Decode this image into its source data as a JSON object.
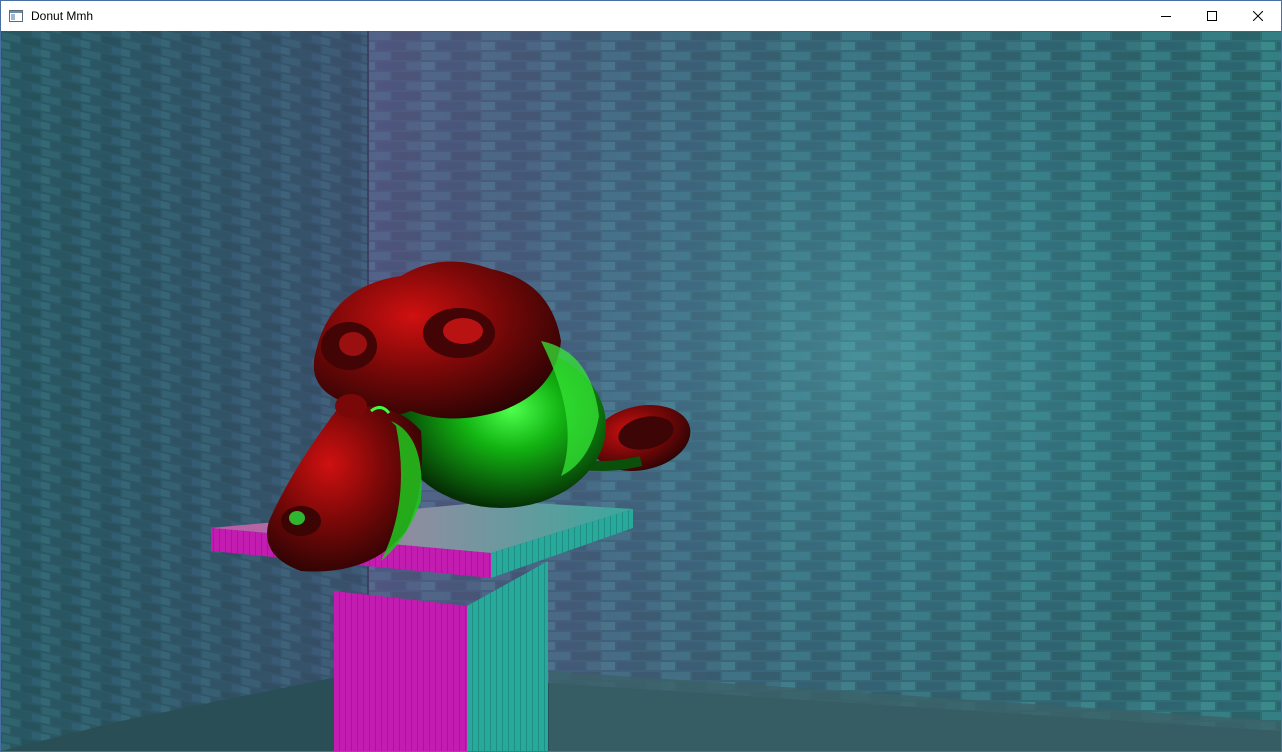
{
  "window": {
    "title": "Donut Mmh",
    "icon": "app-window-icon"
  },
  "caption_buttons": {
    "minimize_icon": "minimize-icon",
    "maximize_icon": "maximize-icon",
    "close_icon": "close-icon"
  },
  "scene": {
    "description_colors": {
      "wall_base": "#2f7a7a",
      "wall_highlight": "#3ab3ad",
      "wall_shadow": "#4a3f66",
      "pillar_front": "#c81fb4",
      "pillar_side": "#27b3a3",
      "head_red": "#8a0a0a",
      "head_green": "#1fc21f"
    }
  }
}
